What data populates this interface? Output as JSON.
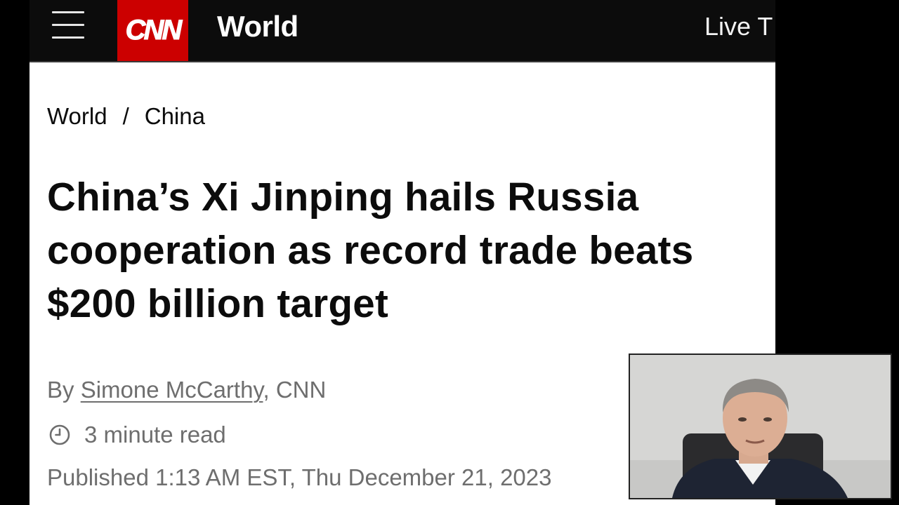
{
  "header": {
    "logo_text": "CNN",
    "section_title": "World",
    "live_tv": "Live T"
  },
  "breadcrumb": {
    "items": [
      "World",
      "China"
    ],
    "separator": "/"
  },
  "article": {
    "headline": "China’s Xi Jinping hails Russia cooperation as record trade beats $200 billion target",
    "byline_prefix": "By ",
    "author": "Simone McCarthy",
    "byline_suffix": ", CNN",
    "read_time": "3 minute read",
    "published": "Published 1:13 AM EST, Thu December 21, 2023"
  },
  "colors": {
    "brand_red": "#cc0000",
    "header_bg": "#0c0c0c",
    "meta_text": "#6e6e6e"
  },
  "icons": {
    "menu": "hamburger-menu-icon",
    "clock": "clock-icon"
  }
}
